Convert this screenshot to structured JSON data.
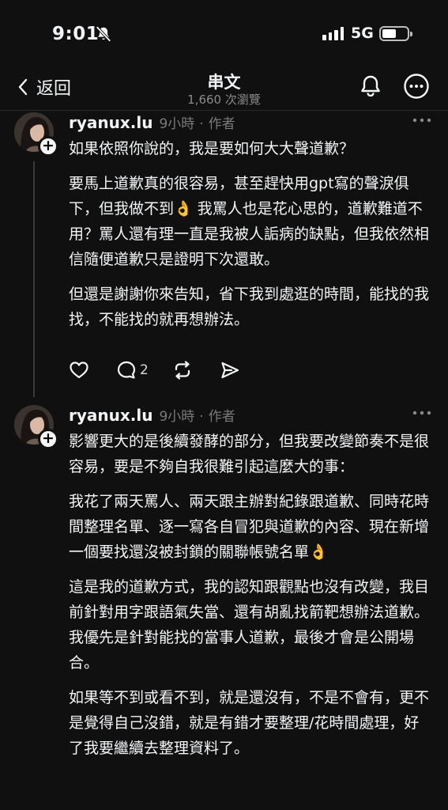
{
  "status_bar": {
    "time": "9:01",
    "network": "5G"
  },
  "nav": {
    "back_label": "返回",
    "title": "串文",
    "views": "1,660 次瀏覽"
  },
  "posts": [
    {
      "username": "ryanux.lu",
      "time": "9小時",
      "separator": "·",
      "role": "作者",
      "paragraphs": [
        "如果依照你說的，我是要如何大大聲道歉？",
        "要馬上道歉真的很容易，甚至趕快用gpt寫的聲淚俱下，但我做不到👌 我罵人也是花心思的，道歉難道不用？罵人還有理一直是我被人詬病的缺點，但我依然相信隨便道歉只是證明下次還敢。",
        "但還是謝謝你來告知，省下我到處逛的時間，能找的我找，不能找的就再想辦法。"
      ],
      "reply_count": "2"
    },
    {
      "username": "ryanux.lu",
      "time": "9小時",
      "separator": "·",
      "role": "作者",
      "paragraphs": [
        "影響更大的是後續發酵的部分，但我要改變節奏不是很容易，要是不夠自我很難引起這麼大的事：",
        "我花了兩天罵人、兩天跟主辦對紀錄跟道歉、同時花時間整理名單、逐一寫各自冒犯與道歉的內容、現在新增一個要找還沒被封鎖的關聯帳號名單👌",
        "這是我的道歉方式，我的認知跟觀點也沒有改變，我目前針對用字跟語氣失當、還有胡亂找箭靶想辦法道歉。我優先是針對能找的當事人道歉，最後才會是公開場合。",
        "如果等不到或看不到，就是還沒有，不是不會有，更不是覺得自己沒錯，就是有錯才要整理/花時間處理，好了我要繼續去整理資料了。"
      ]
    }
  ]
}
